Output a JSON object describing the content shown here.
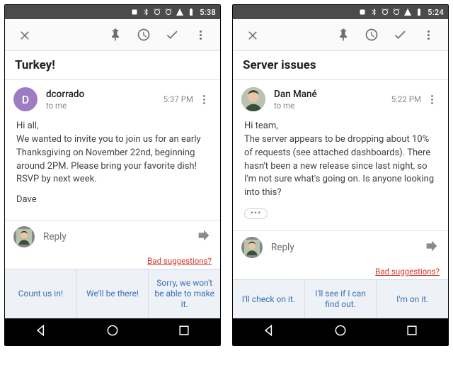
{
  "phones": [
    {
      "status": {
        "time": "5:38"
      },
      "subject": "Turkey!",
      "sender": {
        "name": "dcorrado",
        "to": "to me",
        "timestamp": "5:37 PM",
        "avatar": {
          "kind": "letter",
          "letter": "D",
          "color": "#9e7cc1"
        }
      },
      "body": {
        "greeting": "Hi all,",
        "paragraph": " We wanted to invite you to join us for an early Thanksgiving on November 22nd, beginning around 2PM.  Please bring your favorite dish!  RSVP by next week.",
        "signoff": "Dave",
        "show_ellipsis": false
      },
      "reply_label": "Reply",
      "bad_link": "Bad suggestions?",
      "suggestions": [
        "Count us in!",
        "We'll be there!",
        "Sorry, we won't be able to make it."
      ]
    },
    {
      "status": {
        "time": "5:24"
      },
      "subject": "Server issues",
      "sender": {
        "name": "Dan Mané",
        "to": "to me",
        "timestamp": "5:22 PM",
        "avatar": {
          "kind": "photo"
        }
      },
      "body": {
        "greeting": "Hi team,",
        "paragraph": "The server appears to be dropping about 10% of requests (see attached dashboards).  There hasn't been a new release since last night, so I'm not sure what's going on.  Is anyone looking into this?",
        "signoff": "",
        "show_ellipsis": true
      },
      "reply_label": "Reply",
      "bad_link": "Bad suggestions?",
      "suggestions": [
        "I'll check on it.",
        "I'll see if I can find out.",
        "I'm on it."
      ]
    }
  ]
}
